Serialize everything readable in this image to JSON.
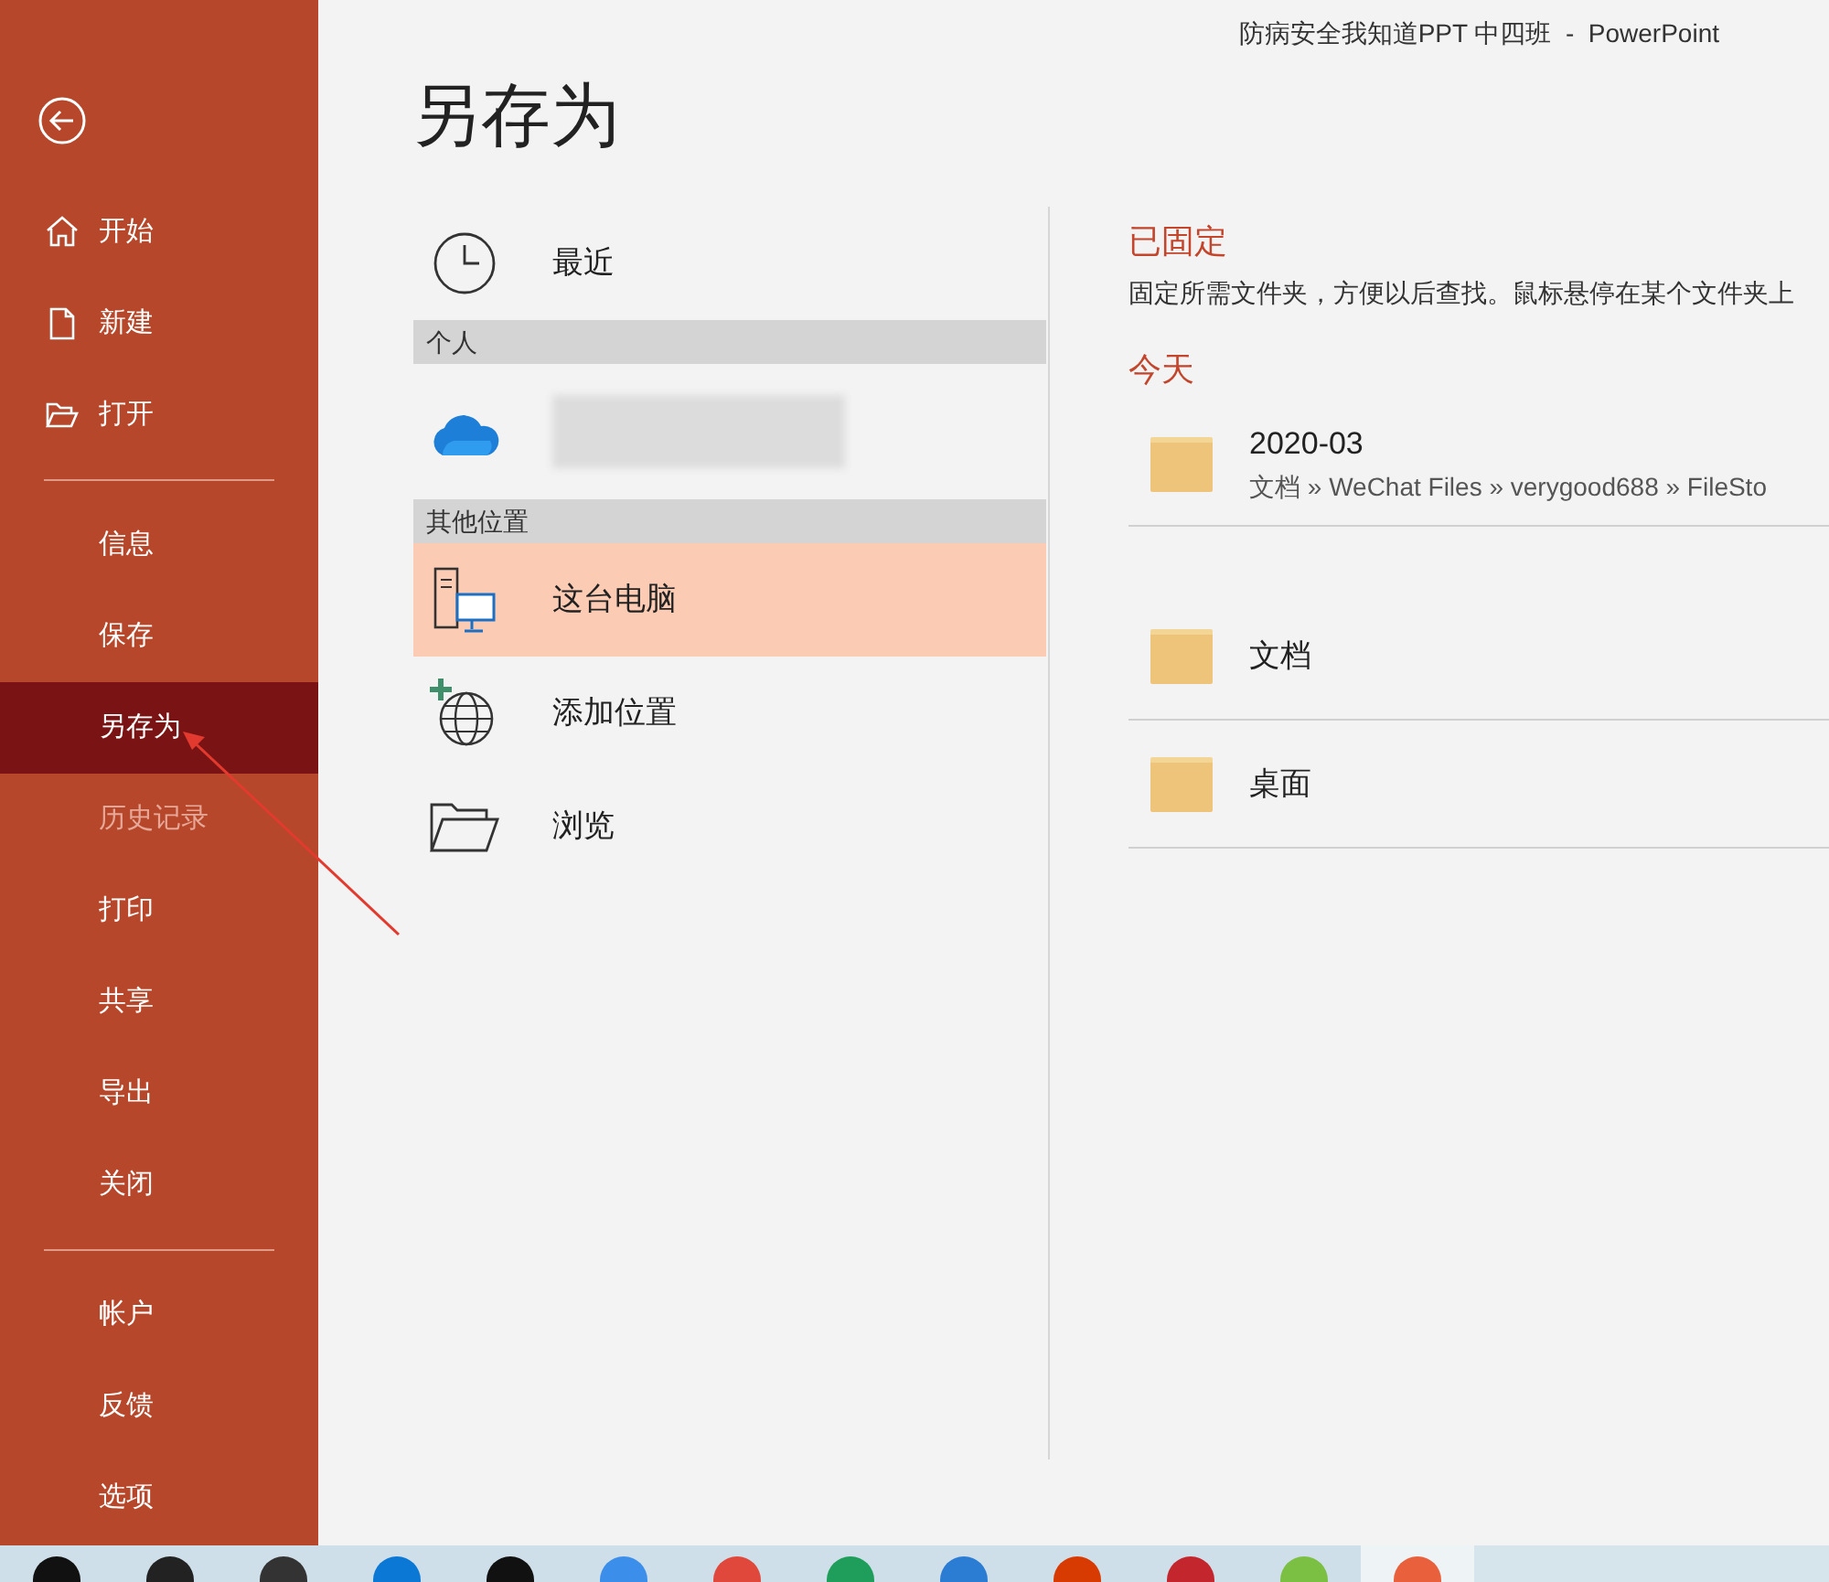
{
  "window": {
    "title": "防病安全我知道PPT 中四班  -  PowerPoint"
  },
  "sidebar": {
    "groups": [
      [
        {
          "label": "开始",
          "kind": "home",
          "selected": false,
          "disabled": false
        },
        {
          "label": "新建",
          "kind": "new",
          "selected": false,
          "disabled": false
        },
        {
          "label": "打开",
          "kind": "open",
          "selected": false,
          "disabled": false
        }
      ],
      [
        {
          "label": "信息",
          "kind": "text",
          "selected": false,
          "disabled": false
        },
        {
          "label": "保存",
          "kind": "text",
          "selected": false,
          "disabled": false
        },
        {
          "label": "另存为",
          "kind": "text",
          "selected": true,
          "disabled": false
        },
        {
          "label": "历史记录",
          "kind": "text",
          "selected": false,
          "disabled": true
        },
        {
          "label": "打印",
          "kind": "text",
          "selected": false,
          "disabled": false
        },
        {
          "label": "共享",
          "kind": "text",
          "selected": false,
          "disabled": false
        },
        {
          "label": "导出",
          "kind": "text",
          "selected": false,
          "disabled": false
        },
        {
          "label": "关闭",
          "kind": "text",
          "selected": false,
          "disabled": false
        }
      ],
      [
        {
          "label": "帐户",
          "kind": "text",
          "selected": false,
          "disabled": false
        },
        {
          "label": "反馈",
          "kind": "text",
          "selected": false,
          "disabled": false
        },
        {
          "label": "选项",
          "kind": "text",
          "selected": false,
          "disabled": false
        }
      ]
    ]
  },
  "page_title": "另存为",
  "locations": [
    {
      "kind": "recent",
      "label": "最近",
      "selected": false
    },
    {
      "kind": "heading",
      "label": "个人"
    },
    {
      "kind": "onedrive",
      "selected": false
    },
    {
      "kind": "heading",
      "label": "其他位置"
    },
    {
      "kind": "pc",
      "label": "这台电脑",
      "selected": true
    },
    {
      "kind": "add",
      "label": "添加位置",
      "selected": false
    },
    {
      "kind": "browse",
      "label": "浏览",
      "selected": false
    }
  ],
  "pinned": {
    "heading": "已固定",
    "description": "固定所需文件夹，方便以后查找。鼠标悬停在某个文件夹上"
  },
  "today": {
    "heading": "今天",
    "folders": [
      {
        "name": "2020-03",
        "path": "文档 » WeChat Files » verygood688 » FileSto"
      }
    ]
  },
  "other_folders": [
    {
      "name": "文档"
    },
    {
      "name": "桌面"
    }
  ],
  "taskbar": {
    "apps": [
      {
        "color": "#111111",
        "active": false
      },
      {
        "color": "#222222",
        "active": false
      },
      {
        "color": "#333333",
        "active": false
      },
      {
        "color": "#0a78d4",
        "active": false
      },
      {
        "color": "#111111",
        "active": false
      },
      {
        "color": "#3b8eea",
        "active": false
      },
      {
        "color": "#e0483b",
        "active": false
      },
      {
        "color": "#1e9e5a",
        "active": false
      },
      {
        "color": "#2b7cd3",
        "active": false
      },
      {
        "color": "#d83b01",
        "active": false
      },
      {
        "color": "#c4262e",
        "active": false
      },
      {
        "color": "#7bc043",
        "active": false
      },
      {
        "color": "#e8603c",
        "active": true
      }
    ]
  }
}
